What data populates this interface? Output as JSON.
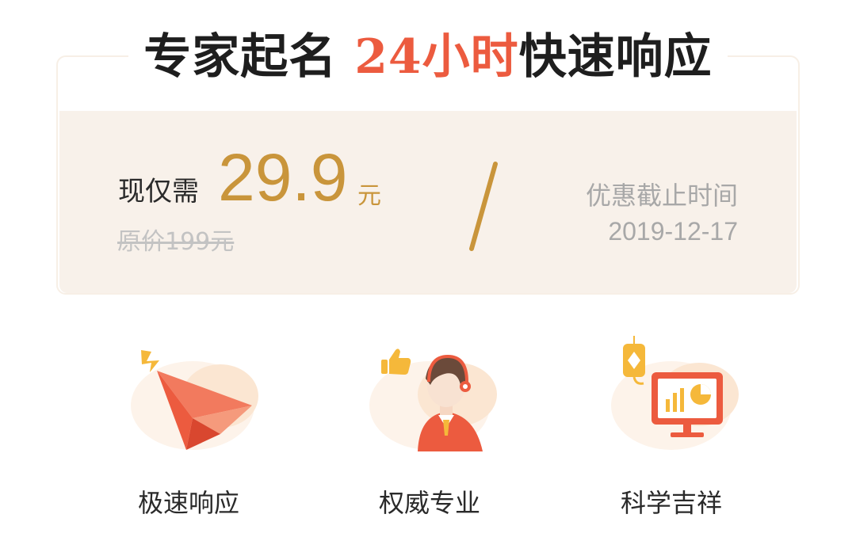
{
  "header": {
    "title_prefix": "专家起名",
    "title_accent": "24小时",
    "title_suffix": "快速响应"
  },
  "pricing": {
    "now_label": "现仅需",
    "price": "29.9",
    "unit": "元",
    "original_price": "原价199元",
    "deadline_label": "优惠截止时间",
    "deadline_date": "2019-12-17"
  },
  "features": [
    {
      "label": "极速响应",
      "icon": "paper-plane-icon"
    },
    {
      "label": "权威专业",
      "icon": "consultant-icon"
    },
    {
      "label": "科学吉祥",
      "icon": "monitor-chart-icon"
    }
  ],
  "colors": {
    "accent_red": "#ec5b3f",
    "price_gold": "#c9953b",
    "panel_bg": "#f8f1ea"
  }
}
